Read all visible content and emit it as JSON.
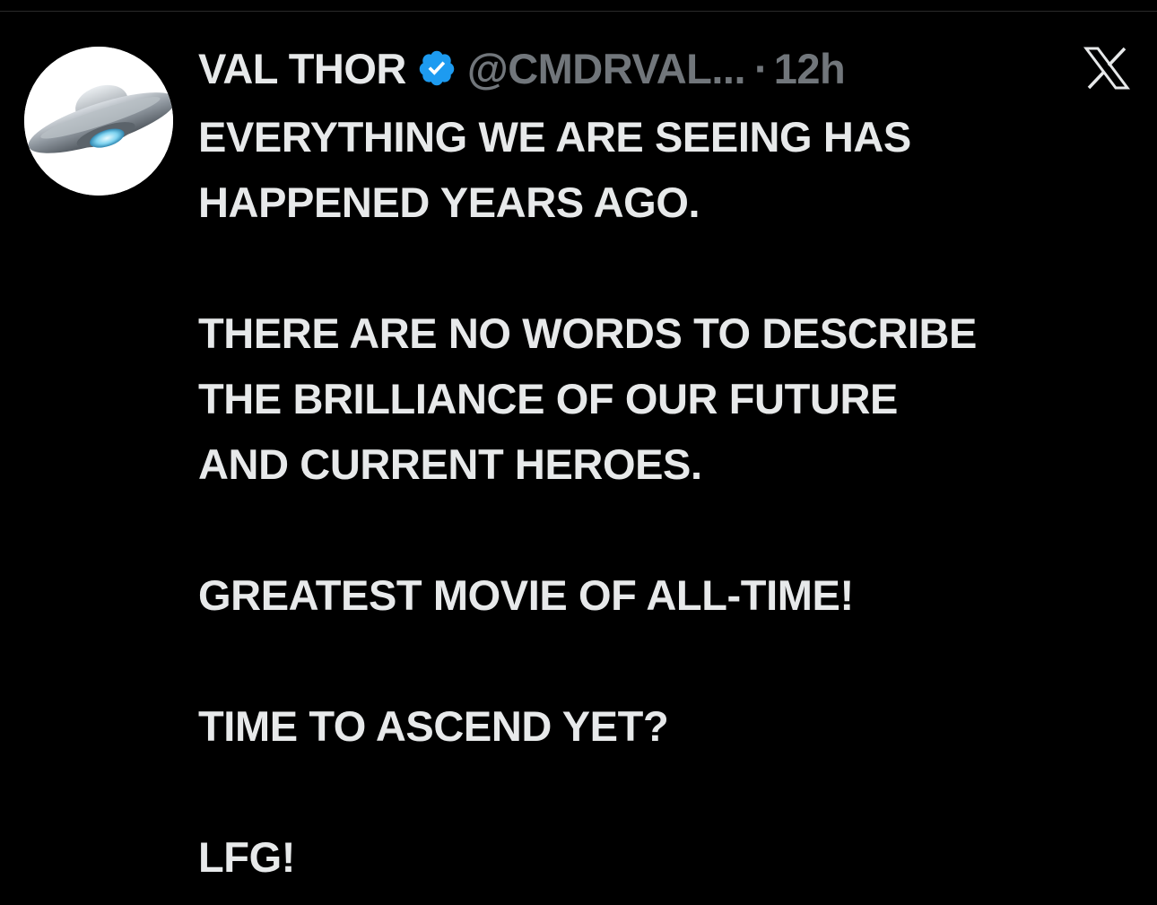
{
  "tweet": {
    "author": {
      "display_name": "VAL THOR",
      "handle": "@CMDRVAL...",
      "verified_icon": "verified-badge-icon",
      "avatar_icon": "ufo-avatar-icon"
    },
    "separator": "·",
    "timestamp": "12h",
    "platform_icon": "x-logo-icon",
    "paragraphs": [
      "EVERYTHING WE ARE SEEING HAS\nHAPPENED YEARS AGO.",
      "THERE ARE NO WORDS TO DESCRIBE\nTHE BRILLIANCE OF OUR FUTURE\nAND CURRENT HEROES.",
      "GREATEST MOVIE OF ALL-TIME!",
      "TIME TO ASCEND YET?",
      "LFG!"
    ]
  },
  "colors": {
    "background": "#000000",
    "text": "#e7e9ea",
    "secondary_text": "#71767b",
    "verified_blue": "#1d9bf0"
  }
}
